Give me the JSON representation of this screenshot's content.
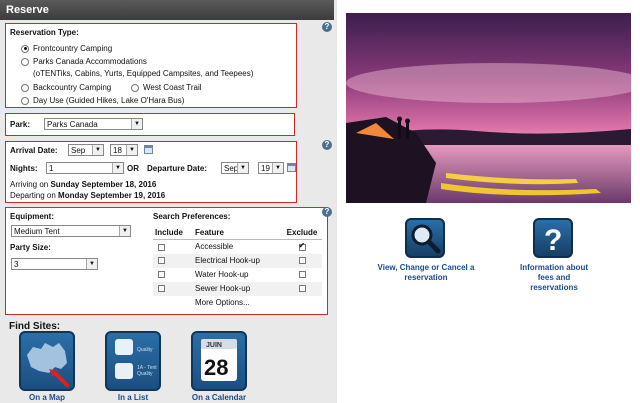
{
  "panel": {
    "title": "Reserve"
  },
  "reservation_type": {
    "heading": "Reservation Type:",
    "options": [
      {
        "label": "Frontcountry Camping",
        "selected": true
      },
      {
        "label": "Parks Canada Accommodations",
        "sub": "(oTENTiks, Cabins, Yurts, Equipped Campsites, and Teepees)",
        "selected": false
      },
      {
        "label": "Backcountry Camping",
        "selected": false
      },
      {
        "label": "West Coast Trail",
        "selected": false
      },
      {
        "label": "Day Use (Guided Hikes, Lake O'Hara Bus)",
        "selected": false
      }
    ]
  },
  "park": {
    "label": "Park:",
    "value": "Parks Canada"
  },
  "dates": {
    "arrival_label": "Arrival Date:",
    "arrival_month": "Sep",
    "arrival_day": "18",
    "nights_label": "Nights:",
    "nights_value": "1",
    "or_label": "OR",
    "departure_label": "Departure Date:",
    "departure_month": "Sep",
    "departure_day": "19",
    "arriving_prefix": "Arriving on ",
    "arriving_date": "Sunday September 18, 2016",
    "departing_prefix": "Departing on ",
    "departing_date": "Monday September 19, 2016"
  },
  "equipment": {
    "label": "Equipment:",
    "value": "Medium Tent",
    "party_label": "Party Size:",
    "party_value": "3"
  },
  "search_prefs": {
    "heading": "Search Preferences:",
    "columns": [
      "Include",
      "Feature",
      "Exclude"
    ],
    "rows": [
      {
        "feature": "Accessible",
        "include": false,
        "exclude": true
      },
      {
        "feature": "Electrical Hook-up",
        "include": false,
        "exclude": false
      },
      {
        "feature": "Water Hook-up",
        "include": false,
        "exclude": false
      },
      {
        "feature": "Sewer Hook-up",
        "include": false,
        "exclude": false
      },
      {
        "feature": "More Options..."
      }
    ]
  },
  "find_sites": {
    "heading": "Find Sites:",
    "buttons": [
      {
        "label": "On a Map",
        "icon": "canada-map-icon"
      },
      {
        "label": "In a List",
        "icon": "site-list-icon",
        "item_1": "Quality",
        "item_2": "1A - Tent",
        "item_2b": "Quality"
      },
      {
        "label": "On a Calendar",
        "icon": "calendar-icon",
        "month": "JUIN",
        "day": "28"
      }
    ]
  },
  "help": {
    "glyph": "?"
  },
  "right": {
    "view_change_cancel": "View, Change or Cancel a reservation",
    "info_fees": "Information about fees and reservations"
  },
  "colors": {
    "highlight_border": "#cc2a2a",
    "link": "#1a4b8c",
    "header": "#444444"
  }
}
